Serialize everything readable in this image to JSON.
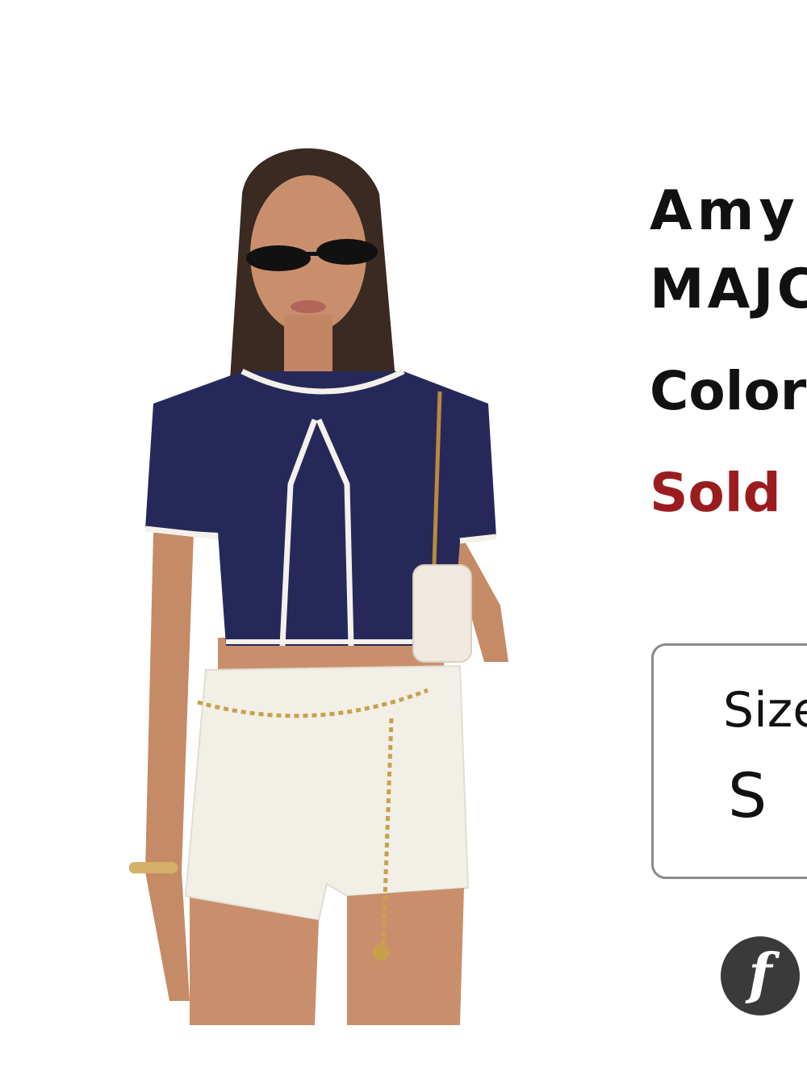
{
  "product": {
    "brand_title": "Amy",
    "designer": "MAJC",
    "color_label": "Color",
    "stock_status": "Sold"
  },
  "size_selector": {
    "label": "Size",
    "value": "S"
  },
  "payment_button": {
    "icon_glyph": "f",
    "icon_name": "f-icon"
  },
  "colors": {
    "stock_status": "#9b1c1f",
    "selector_border": "#8a8a8a",
    "icon_bg": "#3a3a3a",
    "top_navy": "#27285a",
    "trim_white": "#f3f1ea"
  },
  "image": {
    "subject": "model wearing navy cropped cardigan with white trim, white shorts, gold chain belt and white shoulder bag"
  }
}
